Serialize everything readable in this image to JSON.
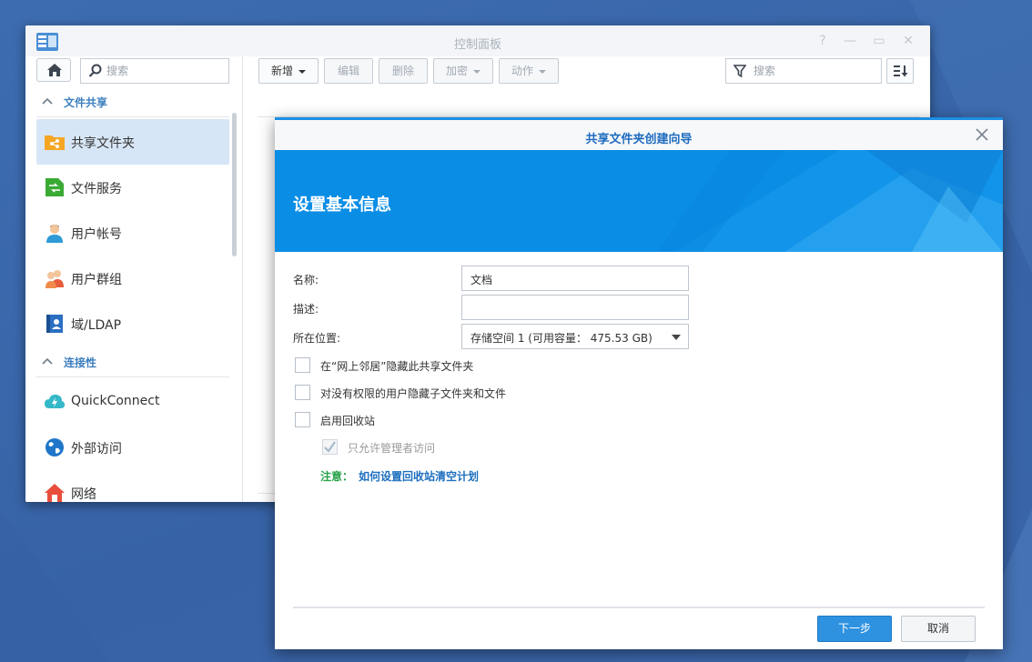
{
  "control_panel": {
    "title": "控制面板",
    "help_glyph": "?",
    "minimize_glyph": "—",
    "maximize_glyph": "▭",
    "close_glyph": "✕",
    "sidebar": {
      "search_placeholder": "搜索",
      "sections": [
        {
          "title": "文件共享",
          "items": [
            {
              "label": "共享文件夹",
              "icon": "shared-folder-icon",
              "active": true
            },
            {
              "label": "文件服务",
              "icon": "file-services-icon"
            },
            {
              "label": "用户帐号",
              "icon": "user-icon"
            },
            {
              "label": "用户群组",
              "icon": "group-icon"
            },
            {
              "label": "域/LDAP",
              "icon": "domain-ldap-icon"
            }
          ]
        },
        {
          "title": "连接性",
          "items": [
            {
              "label": "QuickConnect",
              "icon": "quickconnect-icon"
            },
            {
              "label": "外部访问",
              "icon": "globe-icon"
            },
            {
              "label": "网络",
              "icon": "network-house-icon"
            }
          ]
        }
      ]
    },
    "toolbar": {
      "create_label": "新增",
      "edit_label": "编辑",
      "delete_label": "删除",
      "encrypt_label": "加密",
      "action_label": "动作",
      "search_placeholder": "搜索"
    }
  },
  "wizard": {
    "title": "共享文件夹创建向导",
    "banner_title": "设置基本信息",
    "colors": {
      "accent": "#0a8de5",
      "primary_button": "#2e92e0",
      "note_label": "#2aa34a",
      "link": "#1d6fbf"
    },
    "fields": {
      "name_label": "名称:",
      "name_value": "文档",
      "description_label": "描述:",
      "description_value": "",
      "location_label": "所在位置:",
      "location_value": "存储空间 1 (可用容量： 475.53 GB)"
    },
    "checkboxes": [
      {
        "label": "在“网上邻居”隐藏此共享文件夹",
        "checked": false
      },
      {
        "label": "对没有权限的用户隐藏子文件夹和文件",
        "checked": false
      },
      {
        "label": "启用回收站",
        "checked": false
      },
      {
        "label": "只允许管理者访问",
        "checked": true,
        "disabled": true
      }
    ],
    "note_label": "注意：",
    "note_link": "如何设置回收站清空计划",
    "next_label": "下一步",
    "cancel_label": "取消"
  }
}
